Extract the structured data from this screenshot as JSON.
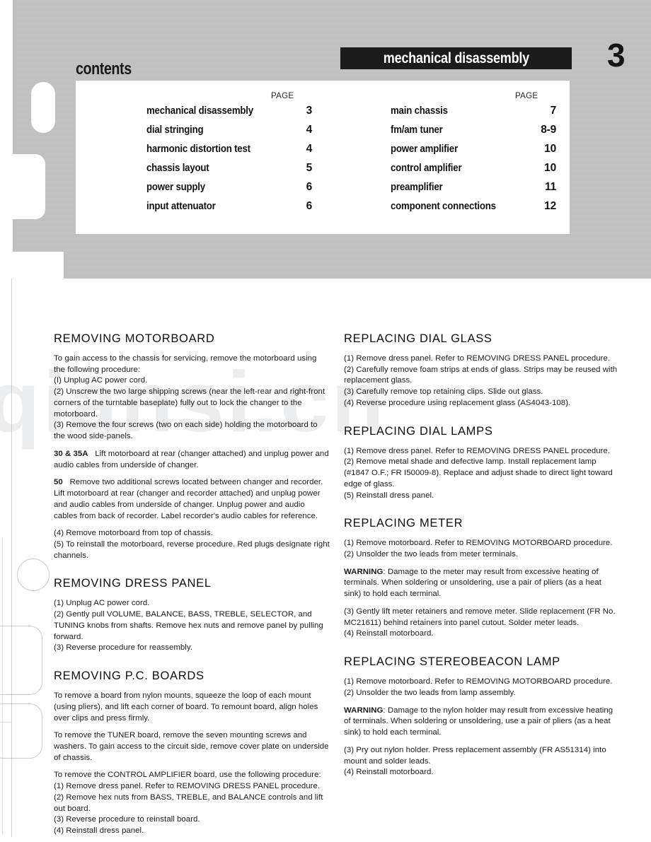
{
  "header": {
    "contents_label": "contents",
    "chapter_banner": "mechanical disassembly",
    "chapter_number": "3",
    "page_column_header": "PAGE"
  },
  "contents": {
    "left": [
      {
        "title": "mechanical disassembly",
        "page": "3"
      },
      {
        "title": "dial stringing",
        "page": "4"
      },
      {
        "title": "harmonic distortion test",
        "page": "4"
      },
      {
        "title": "chassis layout",
        "page": "5"
      },
      {
        "title": "power supply",
        "page": "6"
      },
      {
        "title": "input attenuator",
        "page": "6"
      }
    ],
    "right": [
      {
        "title": "main chassis",
        "page": "7"
      },
      {
        "title": "fm/am tuner",
        "page": "8-9"
      },
      {
        "title": "power amplifier",
        "page": "10"
      },
      {
        "title": "control amplifier",
        "page": "10"
      },
      {
        "title": "preamplifier",
        "page": "11"
      },
      {
        "title": "component connections",
        "page": "12"
      }
    ]
  },
  "watermark": {
    "text": "qiansi.cn"
  },
  "left_column": {
    "sections": [
      {
        "heading": "REMOVING MOTORBOARD",
        "paragraphs": [
          "To gain access to the chassis for servicing, remove the motorboard using the following procedure:",
          "(I) Unplug AC power cord.",
          "(2) Unscrew the two large shipping screws (near the left-rear and right-front corners of the turntable baseplate) fully out to lock the changer to the motorboard.",
          "(3) Remove the four screws (two on each side) holding the motorboard to the wood side-panels.",
          "30 & 35A",
          "Lift motorboard at rear (changer attached) and unplug power and audio cables from underside of changer.",
          "50",
          "Remove two additional screws located between changer and recorder. Lift motorboard at rear (changer and recorder attached) and unplug power and audio cables from underside of changer. Unplug power and audio cables from back of recorder. Label recorder's audio cables for reference.",
          "(4) Remove motorboard from top of chassis.",
          "(5) To reinstall the motorboard, reverse procedure. Red plugs designate right channels."
        ]
      },
      {
        "heading": "REMOVING DRESS PANEL",
        "paragraphs": [
          "(1) Unplug AC power cord.",
          "(2) Gently pull VOLUME, BALANCE, BASS, TREBLE, SELECTOR, and TUNING knobs from shafts. Remove hex nuts and remove panel by pulling forward.",
          "(3) Reverse procedure for reassembly."
        ]
      },
      {
        "heading": "REMOVING P.C. BOARDS",
        "paragraphs": [
          "To remove a board from nylon mounts, squeeze the loop of each mount (using pliers), and lift each corner of board. To remount board, align holes over clips and press firmly.",
          "To remove the TUNER board, remove the seven mounting screws and washers. To gain access to the circuit side, remove cover plate on underside of chassis.",
          "To remove the CONTROL AMPLIFIER board, use the following procedure:",
          "(1) Remove dress panel. Refer to REMOVING DRESS PANEL procedure.",
          "(2) Remove hex nuts from BASS, TREBLE, and BALANCE controls and lift out board.",
          "(3) Reverse procedure to reinstall board.",
          "(4) Reinstall dress panel."
        ]
      }
    ]
  },
  "right_column": {
    "sections": [
      {
        "heading": "REPLACING DIAL GLASS",
        "paragraphs": [
          "(1) Remove dress panel. Refer to REMOVING DRESS PANEL procedure.",
          "(2) Carefully remove foam strips at ends of glass. Strips may be reused with replacement glass.",
          "(3) Carefully remove top retaining clips. Slide out glass.",
          "(4) Reverse procedure using replacement glass (AS4043-108)."
        ]
      },
      {
        "heading": "REPLACING DIAL LAMPS",
        "paragraphs": [
          "(1) Remove dress panel. Refer to REMOVING DRESS PANEL procedure.",
          "(2) Remove metal shade and defective lamp. Install replacement lamp (#1847 O.F.; FR I50009-8). Replace and adjust shade to direct light toward edge of glass.",
          "(5) Reinstall dress panel."
        ]
      },
      {
        "heading": "REPLACING METER",
        "paragraphs": [
          "(1) Remove motorboard. Refer to REMOVING MOTORBOARD procedure.",
          "(2) Unsolder the two leads from meter terminals.",
          "WARNING",
          ": Damage to the meter may result from excessive heating of terminals. When soldering or unsoldering, use a pair of pliers (as a heat sink) to hold each terminal.",
          "(3) Gently lift meter retainers and remove meter. Slide replacement (FR No. MC21611) behind retainers into panel cutout. Solder meter leads.",
          "(4) Reinstall motorboard."
        ]
      },
      {
        "heading": "REPLACING STEREOBEACON LAMP",
        "paragraphs": [
          "(1) Remove motorboard. Refer to REMOVING MOTORBOARD procedure.",
          "(2) Unsolder the two leads from lamp assembly.",
          "WARNING",
          ": Damage to the nylon holder may result from excessive heating of terminals. When soldering or unsoldering, use a pair of pliers (as a heat sink) to hold each terminal.",
          "(3) Pry out nylon holder. Press replacement assembly (FR AS51314) into mount and solder leads.",
          "(4) Reinstall motorboard."
        ]
      }
    ]
  }
}
